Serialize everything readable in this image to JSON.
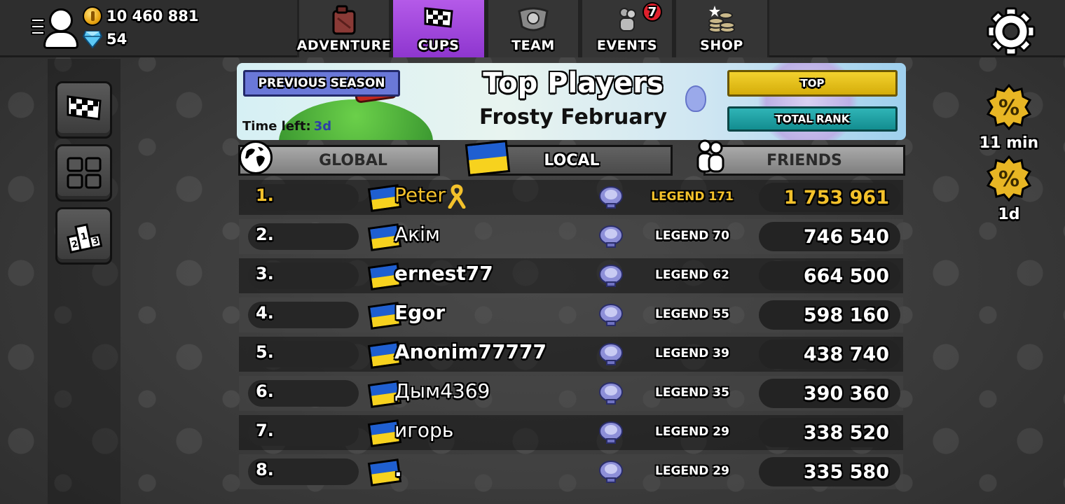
{
  "topbar": {
    "coins": "10 460 881",
    "gems": "54",
    "tabs": [
      {
        "label": "ADVENTURE",
        "icon": "fuel-can-icon",
        "active": false
      },
      {
        "label": "CUPS",
        "icon": "checkered-flag-icon",
        "active": true
      },
      {
        "label": "TEAM",
        "icon": "team-emblem-icon",
        "active": false
      },
      {
        "label": "EVENTS",
        "icon": "events-people-icon",
        "active": false,
        "badge": "7"
      },
      {
        "label": "SHOP",
        "icon": "coins-stack-icon",
        "active": false
      }
    ]
  },
  "banner": {
    "previous_season": "PREVIOUS SEASON",
    "title": "Top Players",
    "subtitle": "Frosty February",
    "time_left_label": "Time left:",
    "time_left_value": "3d",
    "top_button": "TOP",
    "total_rank_button": "TOTAL RANK"
  },
  "filters": {
    "global": "GLOBAL",
    "local": "LOCAL",
    "friends": "FRIENDS",
    "selected": "local"
  },
  "leaderboard": [
    {
      "rank": "1.",
      "name": "Peter",
      "league": "LEGEND 171",
      "score": "1 753 961",
      "highlight": true
    },
    {
      "rank": "2.",
      "name": "Акім",
      "league": "LEGEND 70",
      "score": "746 540"
    },
    {
      "rank": "3.",
      "name": "ernest77",
      "league": "LEGEND 62",
      "score": "664 500"
    },
    {
      "rank": "4.",
      "name": "Egor",
      "league": "LEGEND 55",
      "score": "598 160"
    },
    {
      "rank": "5.",
      "name": "Anonim77777",
      "league": "LEGEND 39",
      "score": "438 740"
    },
    {
      "rank": "6.",
      "name": "Дым4369",
      "league": "LEGEND 35",
      "score": "390 360"
    },
    {
      "rank": "7.",
      "name": "игорь",
      "league": "LEGEND 29",
      "score": "338 520"
    },
    {
      "rank": "8.",
      "name": ".",
      "league": "LEGEND 29",
      "score": "335 580"
    }
  ],
  "deals": [
    {
      "icon": "discount-percent-icon",
      "timer": "11 min"
    },
    {
      "icon": "discount-percent-icon",
      "timer": "1d"
    }
  ],
  "colors": {
    "active_tab": "#9a42d8",
    "gold": "#f3c12b",
    "top_button": "#e8c21c",
    "total_rank_button": "#1fa1a4",
    "previous_season_button": "#6a78d8",
    "ukraine_blue": "#1f5fd1",
    "ukraine_yellow": "#f7d21e"
  }
}
